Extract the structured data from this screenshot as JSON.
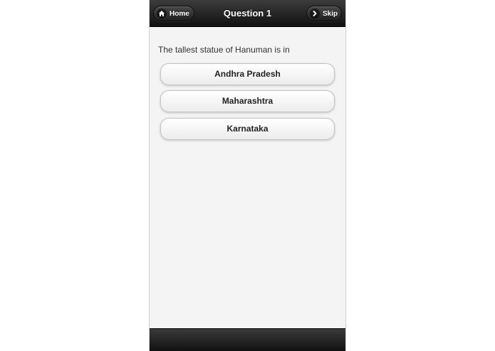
{
  "header": {
    "title": "Question 1",
    "home_label": "Home",
    "skip_label": "Skip",
    "home_icon": "home-icon",
    "skip_icon": "chevron-right-icon"
  },
  "question": {
    "text": "The tallest statue of Hanuman is in"
  },
  "answers": [
    {
      "label": "Andhra Pradesh"
    },
    {
      "label": "Maharashtra"
    },
    {
      "label": "Karnataka"
    }
  ],
  "colors": {
    "header_bg": "#1e1e1e",
    "content_bg": "#f4f4f4",
    "button_bg": "#ffffff"
  }
}
